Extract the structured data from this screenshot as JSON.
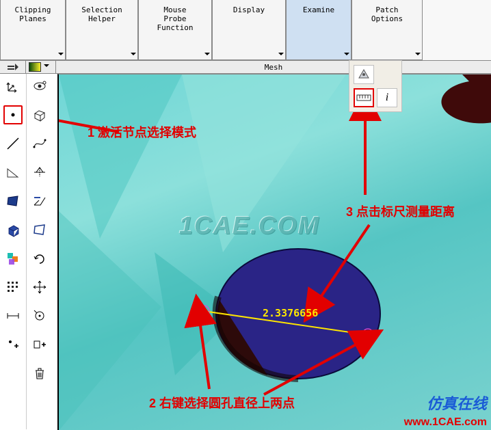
{
  "ribbon": {
    "clipping": "Clipping\nPlanes",
    "selection": "Selection\nHelper",
    "mouse_probe": "Mouse\nProbe\nFunction",
    "display": "Display",
    "examine": "Examine",
    "patch": "Patch\nOptions"
  },
  "subbar": {
    "title": "Mesh"
  },
  "annotations": {
    "a1": "1 激活节点选择模式",
    "a2": "2 右键选择圆孔直径上两点",
    "a3": "3 点击标尺测量距离"
  },
  "measurement": "2.3376656",
  "watermark": "1CAE.COM",
  "brand_cn": "仿真在线",
  "brand_url": "www.1CAE.com",
  "toolbar_left": [
    "axis-arrows",
    "vertex-dot",
    "line-tool",
    "angle-tool",
    "quad-tool",
    "cube-tool",
    "multi-body",
    "grid-points",
    "ruler-tool",
    "plus-point"
  ],
  "toolbar_right": [
    "eye-toggle",
    "wire-cube",
    "spline-curve",
    "project-curve",
    "sweep-curve",
    "quad-outline",
    "redo-arc",
    "pan-crosshair",
    "snap-target",
    "plus-object-right",
    "trash"
  ],
  "popup": {
    "mode": "face-mode",
    "ruler": "ruler",
    "info": "info"
  }
}
